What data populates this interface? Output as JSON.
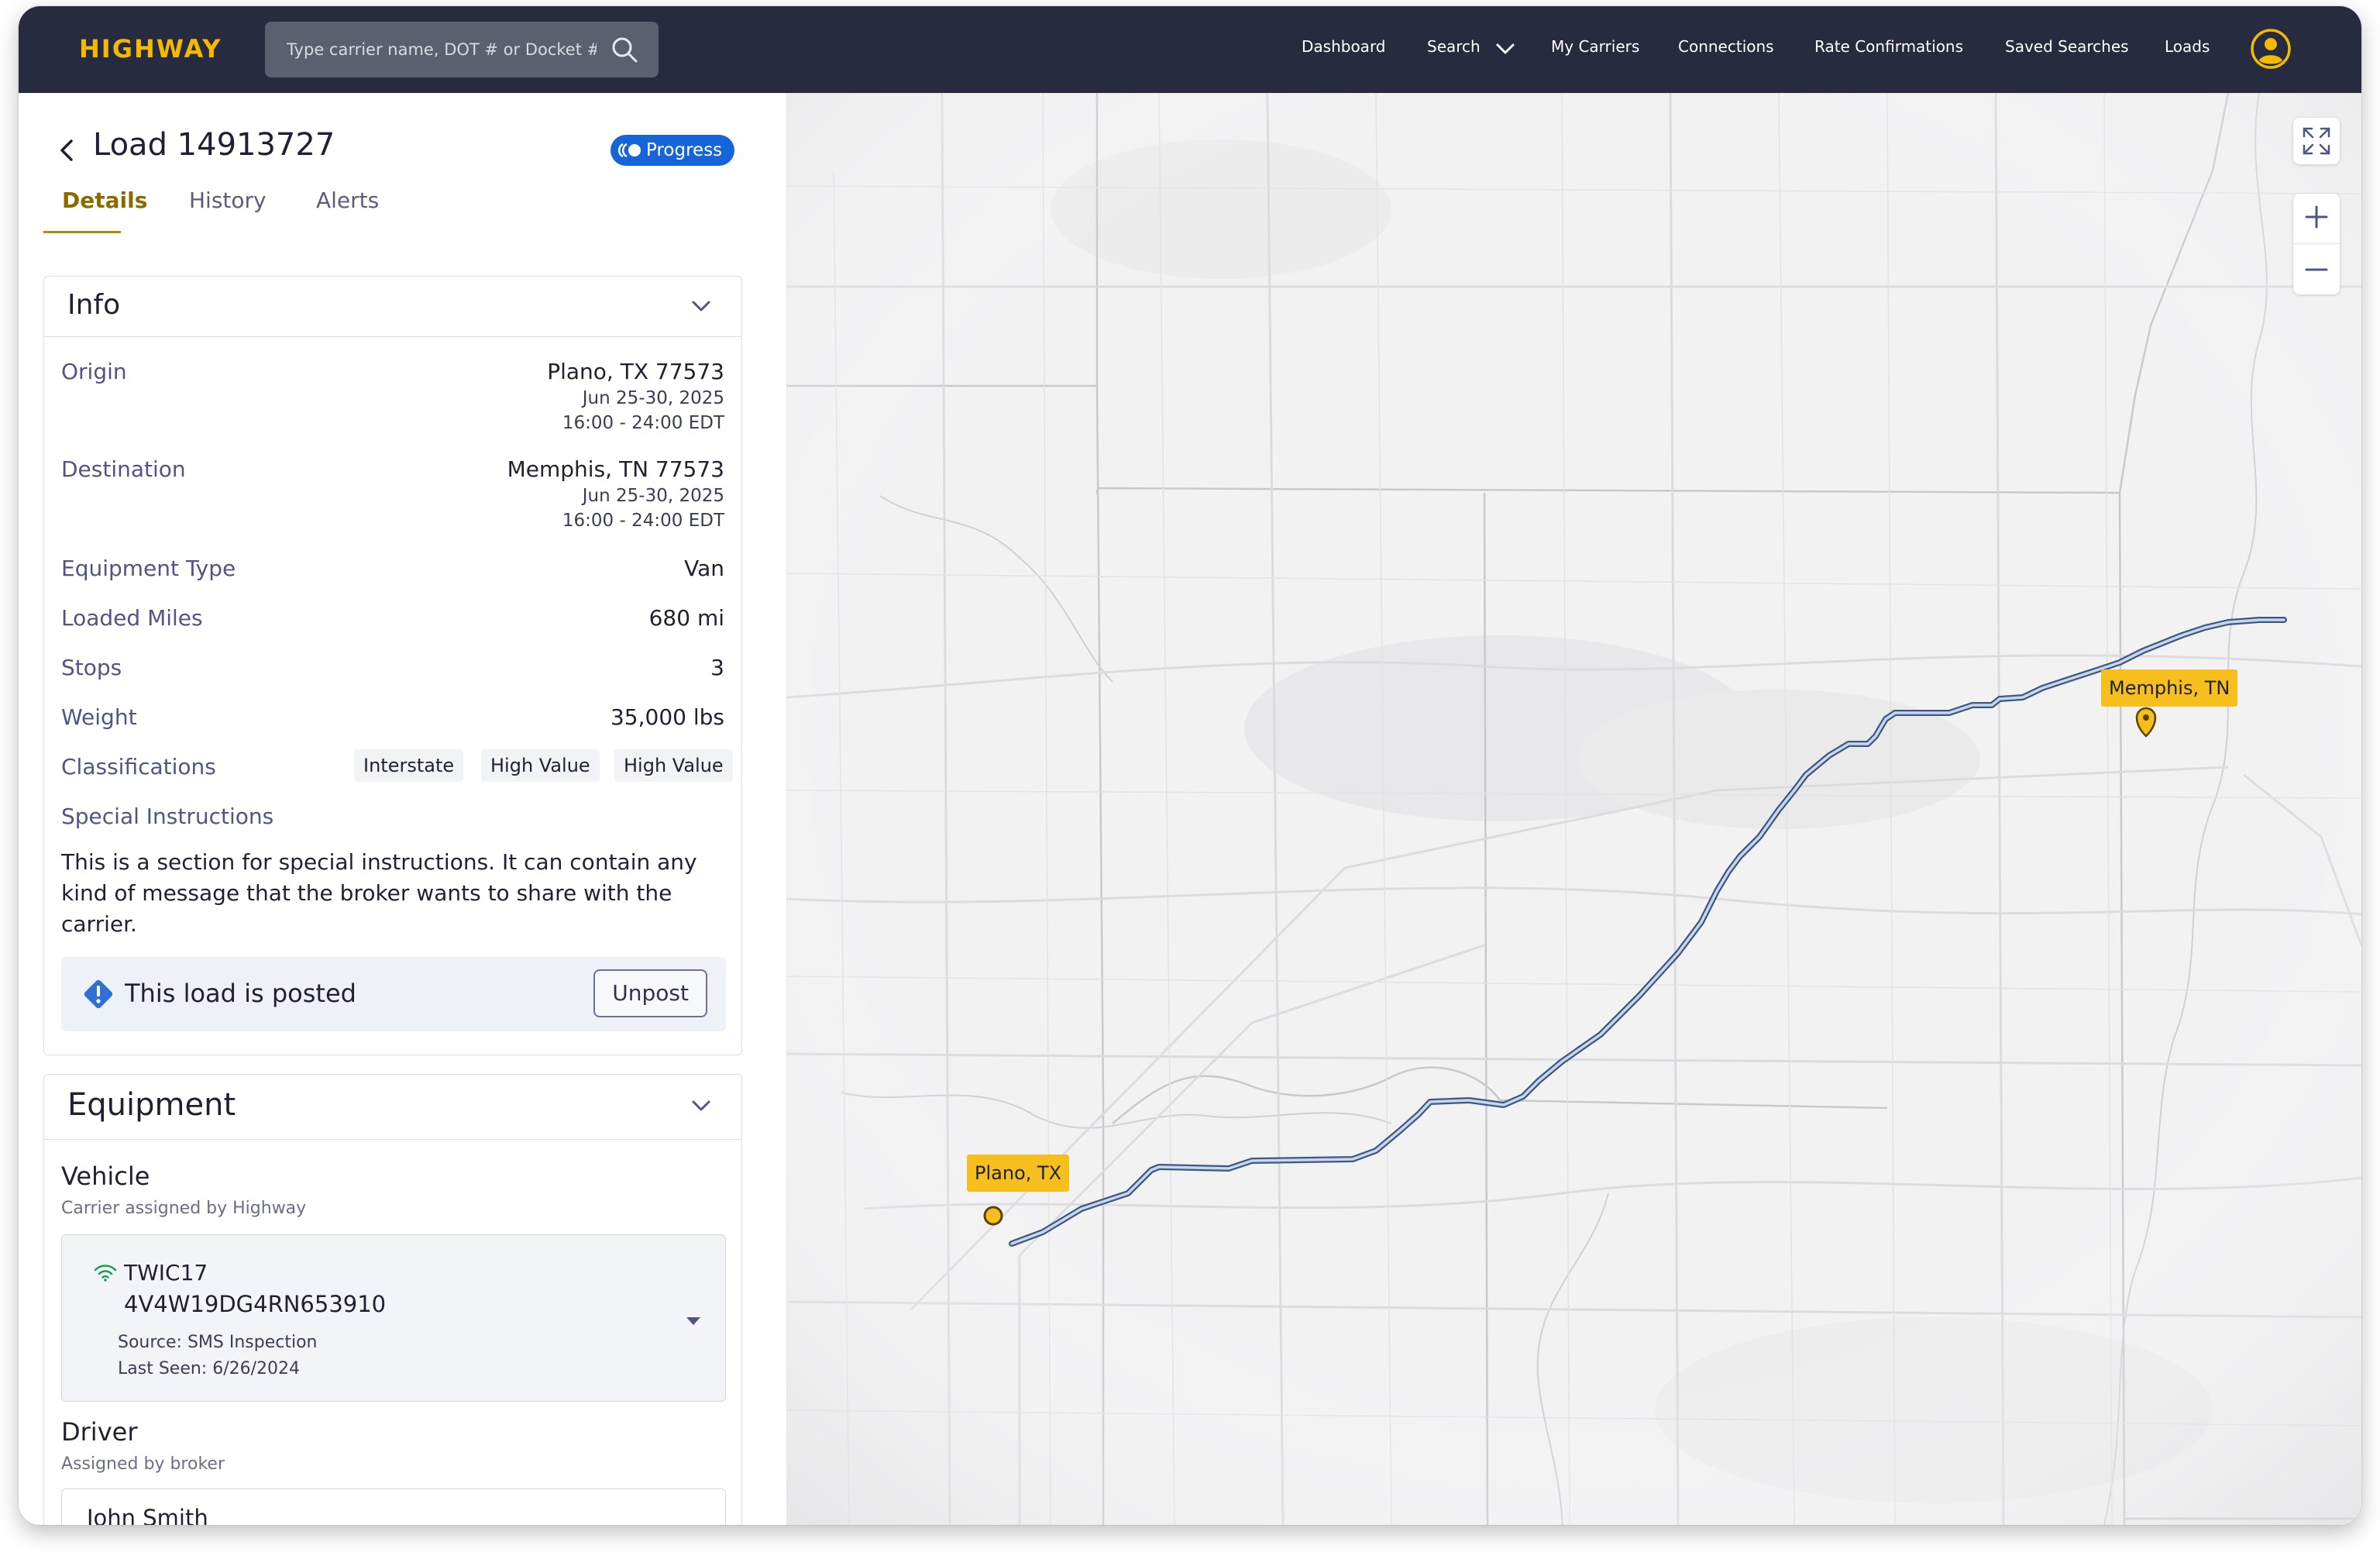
{
  "brand": {
    "logo": "HIGHWAY",
    "accent": "#f5b900",
    "nav_bg": "#262b40",
    "link_blue": "#1565d8"
  },
  "search": {
    "placeholder": "Type carrier name, DOT # or Docket #"
  },
  "nav": {
    "items": [
      "Dashboard",
      "Search",
      "My Carriers",
      "Connections",
      "Rate Confirmations",
      "Saved Searches",
      "Loads"
    ]
  },
  "load": {
    "title": "Load 14913727",
    "status_badge": "Progress",
    "tabs": [
      "Details",
      "History",
      "Alerts"
    ],
    "active_tab": "Details"
  },
  "info": {
    "title": "Info",
    "origin": {
      "label": "Origin",
      "place": "Plano, TX  77573",
      "date": "Jun 25-30, 2025",
      "time": "16:00 - 24:00 EDT"
    },
    "destination": {
      "label": "Destination",
      "place": "Memphis, TN  77573",
      "date": "Jun 25-30, 2025",
      "time": "16:00 - 24:00 EDT"
    },
    "equipment_type": {
      "label": "Equipment Type",
      "value": "Van"
    },
    "loaded_miles": {
      "label": "Loaded Miles",
      "value": "680 mi"
    },
    "stops": {
      "label": "Stops",
      "value": "3"
    },
    "weight": {
      "label": "Weight",
      "value": "35,000 lbs"
    },
    "classifications": {
      "label": "Classifications",
      "chips": [
        "Interstate",
        "High Value",
        "High Value"
      ]
    },
    "special_instructions": {
      "label": "Special Instructions",
      "text": "This is a section for special instructions. It can contain any kind of message that the broker wants to share with the carrier."
    },
    "posted": {
      "text": "This load is posted",
      "button": "Unpost"
    }
  },
  "equipment": {
    "title": "Equipment",
    "vehicle": {
      "heading": "Vehicle",
      "subheading": "Carrier assigned by Highway",
      "id": "TWIC17",
      "vin": "4V4W19DG4RN653910",
      "source": "Source: SMS Inspection",
      "last_seen": "Last Seen: 6/26/2024"
    },
    "driver": {
      "heading": "Driver",
      "subheading": "Assigned by broker",
      "name": "John Smith"
    }
  },
  "map": {
    "origin_label": "Plano, TX",
    "destination_label": "Memphis, TN",
    "route_color": "#5a78a8",
    "marker_color": "#f6bf1e"
  }
}
